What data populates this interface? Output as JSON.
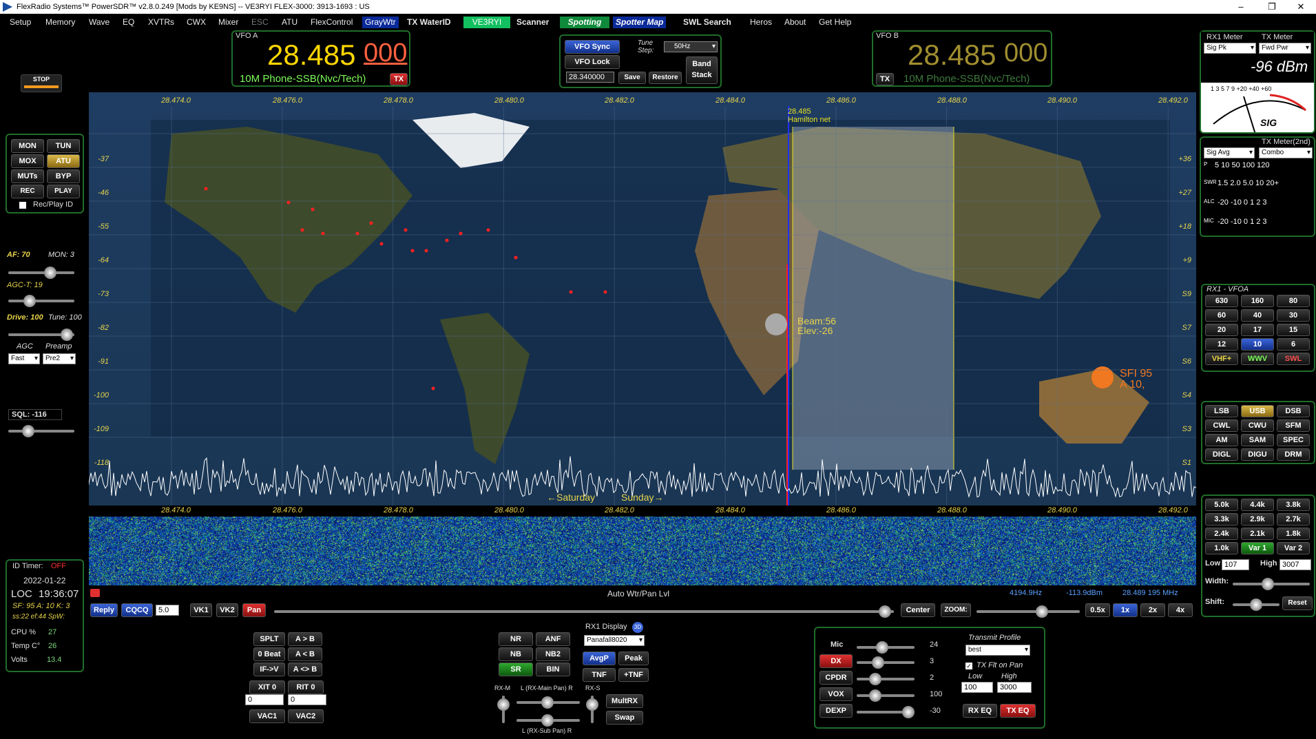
{
  "title": "FlexRadio Systems™  PowerSDR™  v2.8.0.249  [Mods by KE9NS]   --   VE3RYI   FLEX-3000: 3913-1693 : US",
  "window_controls": [
    "–",
    "❐",
    "✕"
  ],
  "menu": [
    "Setup",
    "Memory",
    "Wave",
    "EQ",
    "XVTRs",
    "CWX",
    "Mixer",
    "ESC",
    "ATU",
    "FlexControl",
    "GrayWtr",
    "TX WaterID",
    "VE3RYI",
    "Scanner",
    "Spotting",
    "Spotter Map",
    "SWL Search",
    "Heros",
    "About",
    "Get Help"
  ],
  "stop_label": "STOP",
  "left": {
    "buttons": [
      "MON",
      "TUN",
      "MOX",
      "ATU",
      "MUTs",
      "BYP",
      "REC",
      "PLAY"
    ],
    "recplay": "Rec/Play ID",
    "af": "AF: 70",
    "mon": "MON: 3",
    "agct": "AGC-T: 19",
    "drive": "Drive: 100",
    "tune": "Tune: 100",
    "agc_label": "AGC",
    "preamp_label": "Preamp",
    "agc_value": "Fast",
    "preamp_value": "Pre2",
    "sql": "SQL: -116"
  },
  "status": {
    "id_timer_label": "ID Timer:",
    "id_timer_value": "OFF",
    "date": "2022-01-22",
    "loc_label": "LOC",
    "time": "19:36:07",
    "sf_line": "SF: 95 A: 10 K: 3",
    "ss_line": "ss:22 ef:44 SpW:",
    "cpu_label": "CPU %",
    "cpu": "27",
    "temp_label": "Temp C°",
    "temp": "26",
    "volts_label": "Volts",
    "volts": "13.4"
  },
  "vfoa": {
    "label": "VFO A",
    "freq_main": "28.485",
    "freq_sub": "000",
    "mode": "10M Phone-SSB(Nvc/Tech)",
    "tx": "TX"
  },
  "vfob": {
    "label": "VFO B",
    "freq_main": "28.485",
    "freq_sub": "000",
    "mode": "10M Phone-SSB(Nvc/Tech)",
    "tx": "TX"
  },
  "center": {
    "vfo_sync": "VFO Sync",
    "vfo_lock": "VFO Lock",
    "tune_step_label": "Tune Step:",
    "tune_step": "50Hz",
    "mem_freq": "28.340000",
    "save": "Save",
    "restore": "Restore",
    "band_stack": "Band Stack"
  },
  "rx1meter": {
    "label": "RX1 Meter",
    "tx_label": "TX Meter",
    "rx_mode": "Sig Pk",
    "tx_mode": "Fwd Pwr",
    "reading": "-96 dBm",
    "sig": "SIG",
    "scale": "1  3  5  7  9  +20  +40  +60"
  },
  "txmeter2": {
    "label": "TX Meter(2nd)",
    "left": "Sig Avg",
    "right": "Combo",
    "rows": [
      {
        "k": "P",
        "v": "5    10    50    100 120"
      },
      {
        "k": "SWR",
        "v": "1.5  2.0   5.0  10  20+"
      },
      {
        "k": "ALC",
        "v": "-20    -10      0  1  2  3"
      },
      {
        "k": "MIC",
        "v": "-20    -10      0  1  2  3"
      }
    ]
  },
  "pan": {
    "freq_ticks": [
      "28.474.0",
      "28.476.0",
      "28.478.0",
      "28.480.0",
      "28.482.0",
      "28.484.0",
      "28.486.0",
      "28.488.0",
      "28.490.0",
      "28.492.0"
    ],
    "dbm_left": [
      "-37",
      "-46",
      "-55",
      "-64",
      "-73",
      "-82",
      "-91",
      "-100",
      "-109",
      "-118"
    ],
    "s_right": [
      "+36",
      "+27",
      "+18",
      "+9",
      "S9",
      "S7",
      "S6",
      "S4",
      "S3",
      "S1"
    ],
    "marker_freq": "28.485",
    "marker_name": "Hamilton net",
    "beam": "Beam:56",
    "elev": "Elev:-26",
    "sfi": "SFI 95",
    "a": "A 10,",
    "day_left": "←Saturday",
    "day_right": "Sunday→"
  },
  "wfbar": {
    "label": "Auto Wtr/Pan Lvl",
    "cursor_freq": "4194.9Hz",
    "cursor_dbm": "-113.9dBm",
    "cursor_abs": "28.489 195 MHz",
    "reply": "Reply",
    "cqcq": "CQCQ",
    "cq_val": "5.0",
    "vk1": "VK1",
    "vk2": "VK2",
    "pan": "Pan",
    "center": "Center",
    "zoom": "ZOOM:",
    "zooms": [
      "0.5x",
      "1x",
      "2x",
      "4x"
    ]
  },
  "bottom": {
    "vfo_buttons": [
      "SPLT",
      "A > B",
      "0 Beat",
      "A < B",
      "IF->V",
      "A <> B"
    ],
    "xit": "XIT",
    "xit_v": "0",
    "rit": "RIT",
    "rit_v": "0",
    "xit_num": "0",
    "rit_num": "0",
    "vac1": "VAC1",
    "vac2": "VAC2",
    "dsp": [
      "NR",
      "ANF",
      "NB",
      "NB2",
      "SR",
      "BIN"
    ],
    "rx1display": "RX1 Display",
    "display_mode": "Panafall8020",
    "avgp": "AvgP",
    "peak": "Peak",
    "tnf": "TNF",
    "ptnf": "+TNF",
    "rxm": "RX-M",
    "rxs": "RX-S",
    "lmain": "L (RX-Main Pan) R",
    "lsub": "L (RX-Sub Pan) R",
    "multirx": "MultRX",
    "swap": "Swap",
    "tx": [
      {
        "k": "Mic",
        "v": "24"
      },
      {
        "k": "DX",
        "v": "3"
      },
      {
        "k": "CPDR",
        "v": "2"
      },
      {
        "k": "VOX",
        "v": "100"
      },
      {
        "k": "DEXP",
        "v": "-30"
      }
    ],
    "txprofile_label": "Transmit Profile",
    "txprofile": "best",
    "txflt": "TX Flt on Pan",
    "low_label": "Low",
    "high_label": "High",
    "low": "100",
    "high": "3000",
    "rxeq": "RX EQ",
    "txeq": "TX EQ"
  },
  "bands": {
    "title": "RX1 - VFOA",
    "items": [
      "630",
      "160",
      "80",
      "60",
      "40",
      "30",
      "20",
      "17",
      "15",
      "12",
      "10",
      "6",
      "VHF+",
      "WWV",
      "SWL"
    ]
  },
  "modes": [
    "LSB",
    "USB",
    "DSB",
    "CWL",
    "CWU",
    "SFM",
    "AM",
    "SAM",
    "SPEC",
    "DIGL",
    "DIGU",
    "DRM"
  ],
  "filters": {
    "items": [
      "5.0k",
      "4.4k",
      "3.8k",
      "3.3k",
      "2.9k",
      "2.7k",
      "2.4k",
      "2.1k",
      "1.8k",
      "1.0k",
      "Var 1",
      "Var 2"
    ],
    "low_label": "Low",
    "low": "107",
    "high_label": "High",
    "high": "3007",
    "width": "Width:",
    "shift": "Shift:",
    "reset": "Reset"
  }
}
